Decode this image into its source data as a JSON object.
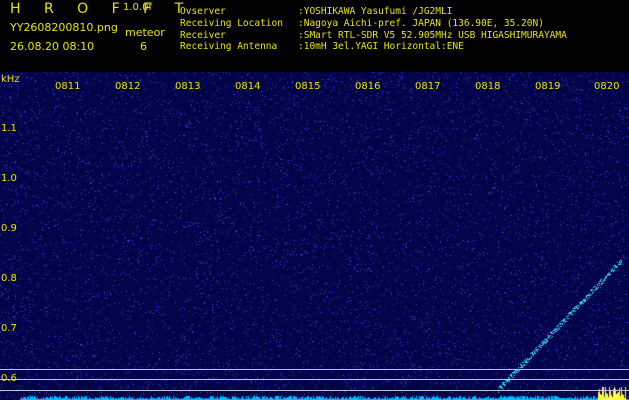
{
  "header": {
    "brand": "H R O F F T",
    "version": "1.0.0f",
    "filename": "YY2608200810.png",
    "timestamp": "26.08.20 08:10",
    "meteor_label": "meteor",
    "meteor_count": "6",
    "info": [
      {
        "key": "Ovserver",
        "value": ":YOSHIKAWA Yasufumi /JG2MLI"
      },
      {
        "key": "Receiving Location",
        "value": ":Nagoya Aichi-pref. JAPAN (136.90E, 35.20N)"
      },
      {
        "key": "Receiver",
        "value": ":SMart RTL-SDR V5 52.905MHz USB HIGASHIMURAYAMA"
      },
      {
        "key": "Receiving Antenna",
        "value": ":10mH 3el.YAGI Horizontal:ENE"
      }
    ]
  },
  "plot": {
    "unit": "kHz",
    "y_ticks": [
      "1.1",
      "1.0",
      "0.9",
      "0.8",
      "0.7",
      "0.6"
    ],
    "x_ticks": [
      "0811",
      "0812",
      "0813",
      "0814",
      "0815",
      "0816",
      "0817",
      "0818",
      "0819",
      "0820"
    ],
    "colors": {
      "background": "#030349",
      "noise": "#3c3cff",
      "echo": "#33e6ff",
      "baseline": "#00c0ff",
      "hline": "#bfbfe0",
      "label": "#e6e600"
    }
  }
}
